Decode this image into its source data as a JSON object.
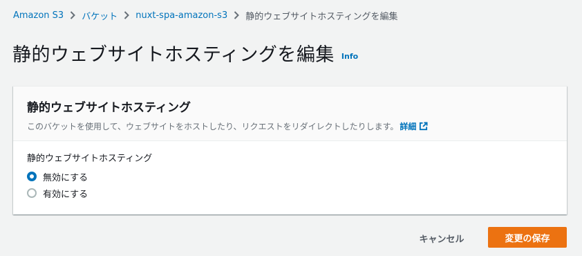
{
  "breadcrumb": {
    "items": [
      {
        "label": "Amazon S3"
      },
      {
        "label": "バケット"
      },
      {
        "label": "nuxt-spa-amazon-s3"
      }
    ],
    "current": "静的ウェブサイトホスティングを編集",
    "separator_icon": "chevron-right-icon"
  },
  "page": {
    "title": "静的ウェブサイトホスティングを編集",
    "info_label": "Info"
  },
  "panel": {
    "title": "静的ウェブサイトホスティング",
    "description": "このバケットを使用して、ウェブサイトをホストしたり、リクエストをリダイレクトしたりします。",
    "detail_link": "詳細",
    "detail_icon": "external-link-icon",
    "field_label": "静的ウェブサイトホスティング",
    "options": [
      {
        "label": "無効にする",
        "checked": true
      },
      {
        "label": "有効にする",
        "checked": false
      }
    ]
  },
  "actions": {
    "cancel_label": "キャンセル",
    "save_label": "変更の保存"
  },
  "colors": {
    "link": "#0073bb",
    "primary_button": "#ec7211",
    "background": "#f2f3f3",
    "radio_checked": "#0073bb"
  }
}
